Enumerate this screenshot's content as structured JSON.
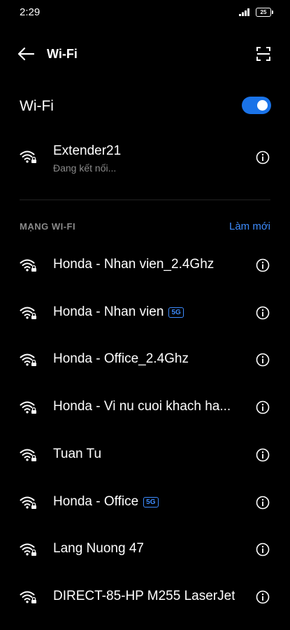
{
  "status_bar": {
    "time": "2:29",
    "battery": "25"
  },
  "header": {
    "title": "Wi-Fi"
  },
  "wifi_toggle": {
    "label": "Wi-Fi",
    "state": "on",
    "color": "#1a73e8"
  },
  "connected": {
    "ssid": "Extender21",
    "status": "Đang kết nối..."
  },
  "section": {
    "title": "MẠNG WI-FI",
    "refresh_label": "Làm mới"
  },
  "networks": [
    {
      "ssid": "Honda - Nhan vien_2.4Ghz",
      "badge": ""
    },
    {
      "ssid": "Honda - Nhan vien",
      "badge": "5G"
    },
    {
      "ssid": "Honda - Office_2.4Ghz",
      "badge": ""
    },
    {
      "ssid": "Honda - Vi nu cuoi khach ha...",
      "badge": ""
    },
    {
      "ssid": "Tuan Tu",
      "badge": ""
    },
    {
      "ssid": "Honda - Office",
      "badge": "5G"
    },
    {
      "ssid": "Lang Nuong 47",
      "badge": ""
    },
    {
      "ssid": "DIRECT-85-HP M255 LaserJet",
      "badge": ""
    }
  ],
  "icons": {
    "back": "arrow-left-icon",
    "scan": "qr-scan-icon",
    "wifi": "wifi-locked-icon",
    "info": "info-icon"
  },
  "colors": {
    "accent": "#3d8bfd",
    "background": "#000000",
    "secondary_text": "#8a8a8a"
  }
}
